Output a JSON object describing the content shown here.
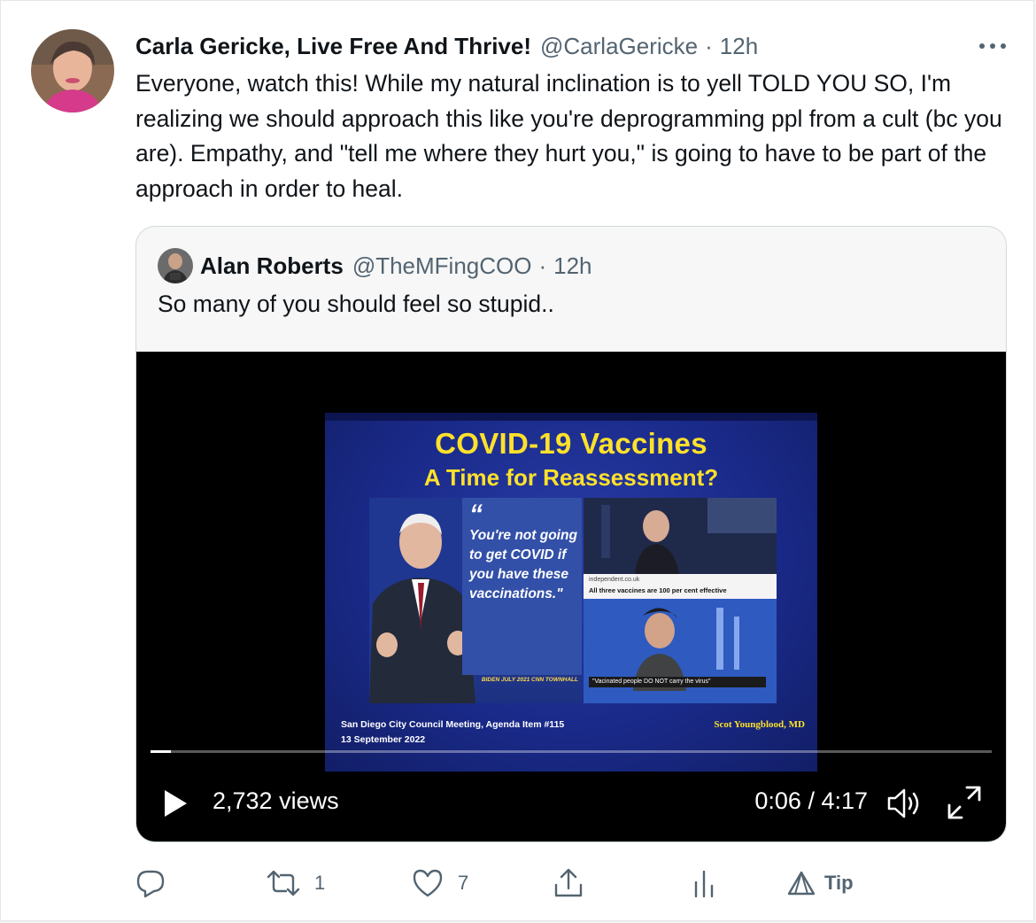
{
  "tweet": {
    "author_name": "Carla Gericke, Live Free And Thrive!",
    "handle": "@CarlaGericke",
    "separator": "·",
    "time": "12h",
    "more_label": "···",
    "text": "Everyone, watch this! While my natural inclination is to yell TOLD YOU SO, I'm realizing we should approach this like you're deprogramming ppl from a cult (bc you are). Empathy, and \"tell me where they hurt you,\" is going to have to be part of the approach in order to heal."
  },
  "quoted": {
    "author_name": "Alan Roberts",
    "handle": "@TheMFingCOO",
    "separator": "·",
    "time": "12h",
    "text": "So many of you should feel so stupid.."
  },
  "video": {
    "slide_title_1": "COVID-19 Vaccines",
    "slide_title_2": "A Time for Reassessment?",
    "quote_mark": "“",
    "quote_text": "You're not going to get COVID if you have these vaccinations.\"",
    "quote_attribution": "BIDEN JULY 2021 CNN TOWNHALL",
    "inset_source": "independent.co.uk",
    "inset_headline": "All three vaccines are 100 per cent effective",
    "inset_caption": "\"Vacinated people DO NOT carry the virus\"",
    "footer_left_1": "San Diego City Council Meeting, Agenda Item #115",
    "footer_left_2": "13 September 2022",
    "footer_right": "Scot Youngblood, MD",
    "views": "2,732 views",
    "duration": "0:06 / 4:17",
    "progress_fraction": 0.024
  },
  "actions": {
    "reply_count": "",
    "retweet_count": "1",
    "like_count": "7",
    "tip_label": "Tip"
  },
  "icons": {
    "reply": "reply-icon",
    "retweet": "retweet-icon",
    "like": "heart-icon",
    "share": "share-icon",
    "analytics": "analytics-icon",
    "tip": "tip-icon",
    "play": "play-icon",
    "volume": "volume-icon",
    "fullscreen": "fullscreen-icon",
    "more": "more-icon"
  },
  "colors": {
    "text_primary": "#0f1419",
    "text_secondary": "#536471",
    "slide_title": "#ffe12a",
    "video_bg": "#000000"
  }
}
